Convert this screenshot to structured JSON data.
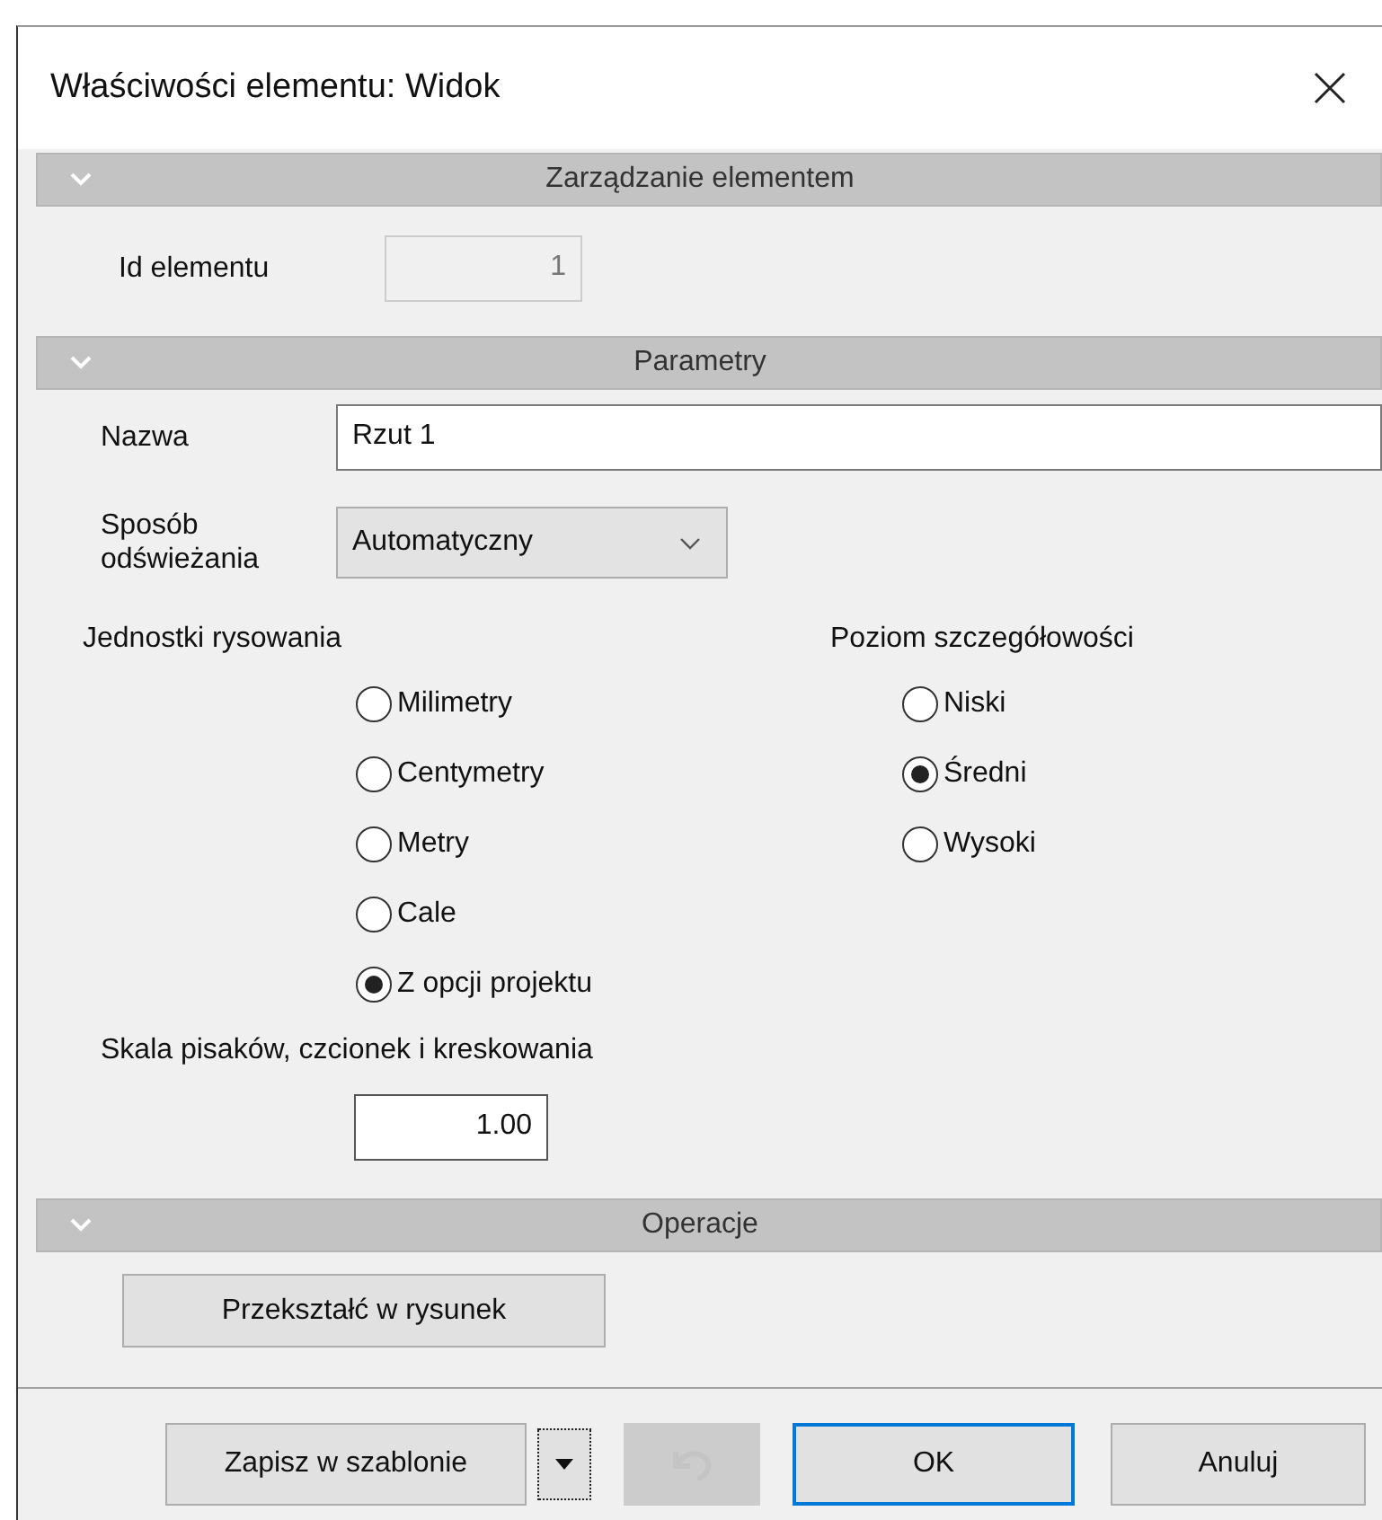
{
  "window": {
    "title": "Właściwości elementu: Widok"
  },
  "sections": [
    {
      "kind": "management",
      "title": "Zarządzanie elementem",
      "expanded": true,
      "id_label": "Id elementu",
      "id_value": "1"
    },
    {
      "kind": "parameters",
      "title": "Parametry",
      "expanded": true,
      "name_label": "Nazwa",
      "name_value": "Rzut 1",
      "refresh_label": "Sposób odświeżania",
      "refresh_value": "Automatyczny",
      "units_label": "Jednostki rysowania",
      "units": [
        {
          "label": "Milimetry",
          "selected": false
        },
        {
          "label": "Centymetry",
          "selected": false
        },
        {
          "label": "Metry",
          "selected": false
        },
        {
          "label": "Cale",
          "selected": false
        },
        {
          "label": "Z opcji projektu",
          "selected": true
        }
      ],
      "detail_label": "Poziom szczegółowości",
      "detail": [
        {
          "label": "Niski",
          "selected": false
        },
        {
          "label": "Średni",
          "selected": true
        },
        {
          "label": "Wysoki",
          "selected": false
        }
      ],
      "scale_label": "Skala pisaków, czcionek i kreskowania",
      "scale_value": "1.00"
    },
    {
      "kind": "operations",
      "title": "Operacje",
      "expanded": true,
      "button": "Przekształć w rysunek"
    }
  ],
  "footer": {
    "template_button": "Zapisz w szablonie",
    "undo_disabled": true,
    "ok_button": "OK",
    "ok_default": true,
    "cancel_button": "Anuluj"
  }
}
